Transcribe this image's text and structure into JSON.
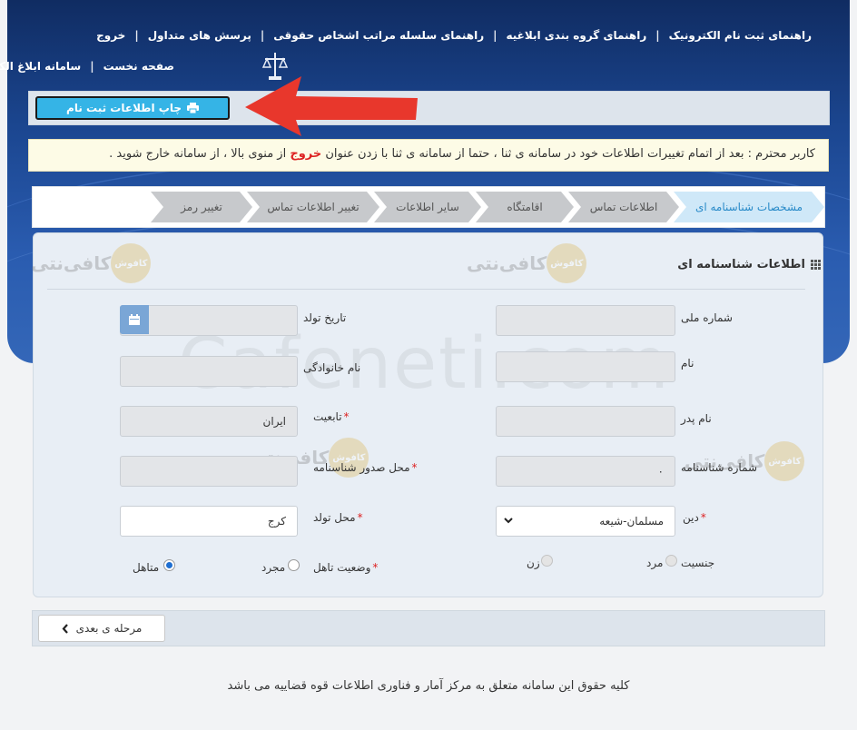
{
  "nav": {
    "row1": [
      "راهنمای ثبت نام الکترونیک",
      "راهنمای گروه بندی ابلاغیه",
      "راهنمای سلسله مراتب اشخاص حقوقی",
      "پرسش های متداول",
      "خروج"
    ],
    "row2": [
      "صفحه نخست",
      "سامانه ابلاغ الکترونیک"
    ]
  },
  "print_button": "چاپ اطلاعات ثبت نام",
  "notice": {
    "before": "کاربر محترم : بعد از اتمام تغییرات اطلاعات خود در سامانه ی ثنا ، حتما از سامانه ی ثنا با زدن عنوان ",
    "highlight": "خروج",
    "after": " از منوی بالا ، از سامانه خارج شوید ."
  },
  "steps": [
    "مشخصات شناسنامه ای",
    "اطلاعات تماس",
    "اقامتگاه",
    "سایر اطلاعات",
    "تغییر اطلاعات تماس",
    "تغییر رمز"
  ],
  "panel_title": "اطلاعات شناسنامه ای",
  "fields": {
    "national_id": {
      "label": "شماره ملی",
      "value": ""
    },
    "birth_date": {
      "label": "تاریخ تولد",
      "value": ""
    },
    "first_name": {
      "label": "نام",
      "value": ""
    },
    "last_name": {
      "label": "نام خانوادگی",
      "value": ""
    },
    "father_name": {
      "label": "نام پدر",
      "value": ""
    },
    "nationality": {
      "label": "تابعیت",
      "value": "ایران"
    },
    "id_number": {
      "label": "شماره شناسنامه",
      "value": "۰"
    },
    "issue_place": {
      "label": "محل صدور شناسنامه",
      "value": ""
    },
    "religion": {
      "label": "دین",
      "value": "مسلمان-شیعه"
    },
    "birth_place": {
      "label": "محل تولد",
      "value": "کرج"
    }
  },
  "gender": {
    "label": "جنسیت",
    "options": [
      "مرد",
      "زن"
    ]
  },
  "marital": {
    "label": "وضعیت تاهل",
    "options": [
      "مجرد",
      "متاهل"
    ],
    "selected": "متاهل"
  },
  "next_button": "مرحله ی بعدی",
  "footer": "کلیه حقوق این سامانه متعلق به مرکز آمار و فناوری اطلاعات قوه قضاییه می باشد",
  "watermark": "Cafeneti.com",
  "logo_text": "کافی‌نتی",
  "logo_badge": "کافوش",
  "colors": {
    "accent": "#35b4e6",
    "header": "#1b4690",
    "required": "#dd2222"
  }
}
